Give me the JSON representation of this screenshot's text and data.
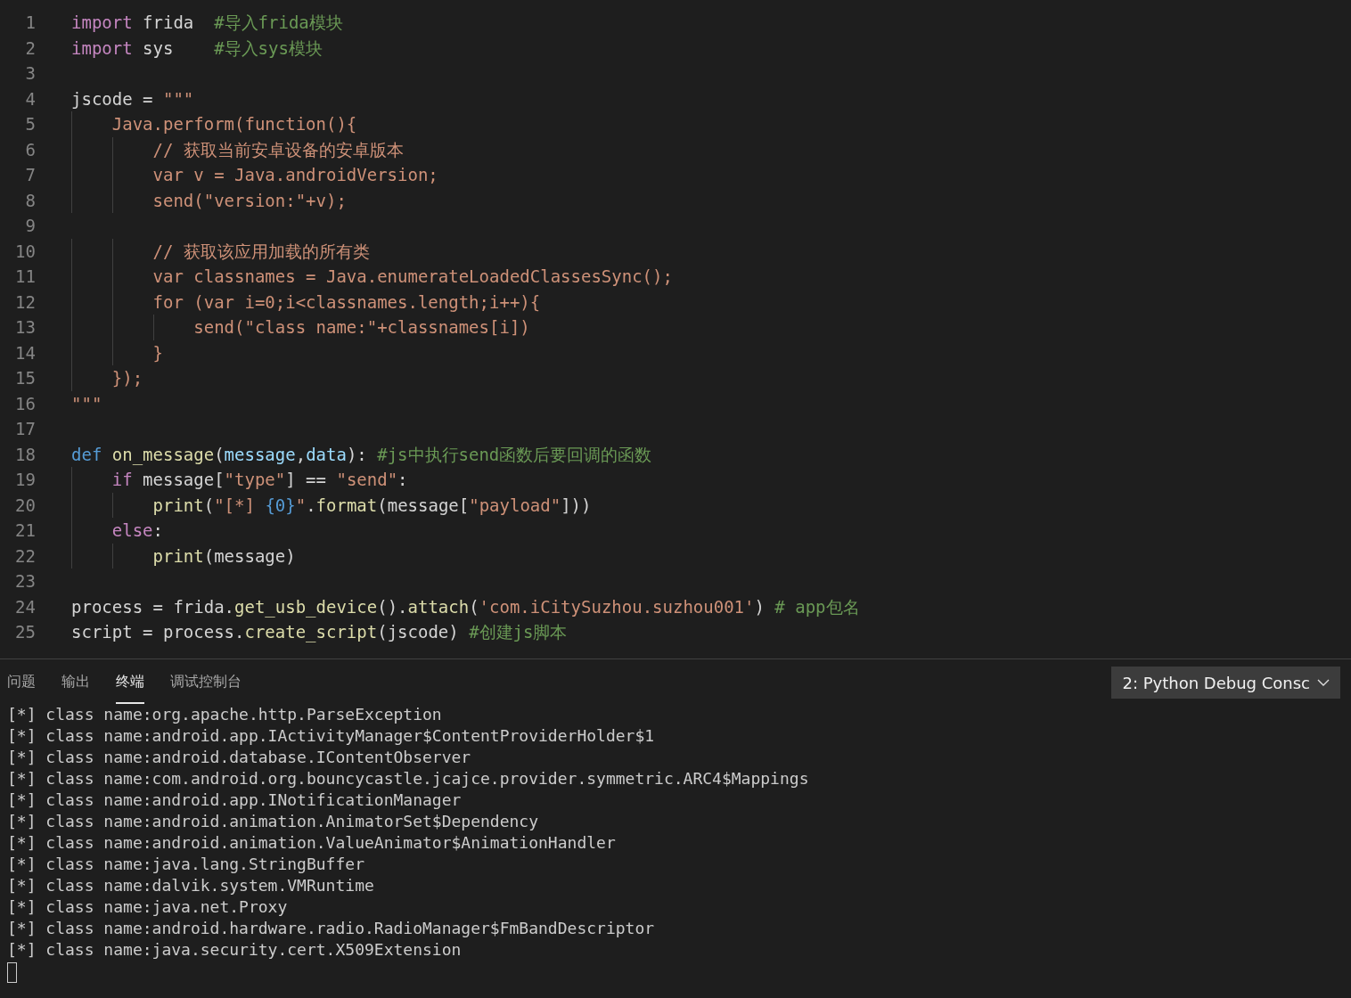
{
  "editor": {
    "lines": [
      {
        "number": "1",
        "tokens": [
          {
            "kind": "keyword",
            "text": "import"
          },
          {
            "kind": "plain",
            "text": " frida  "
          },
          {
            "kind": "comment",
            "text": "#导入frida模块"
          }
        ]
      },
      {
        "number": "2",
        "tokens": [
          {
            "kind": "keyword",
            "text": "import"
          },
          {
            "kind": "plain",
            "text": " sys    "
          },
          {
            "kind": "comment",
            "text": "#导入sys模块"
          }
        ]
      },
      {
        "number": "3"
      },
      {
        "number": "4",
        "tokens": [
          {
            "kind": "plain",
            "text": "jscode = "
          },
          {
            "kind": "string",
            "text": "\"\"\""
          }
        ]
      },
      {
        "number": "5",
        "tokens": [
          {
            "kind": "string",
            "text": "    Java.perform(function(){"
          }
        ]
      },
      {
        "number": "6",
        "tokens": [
          {
            "kind": "string",
            "text": "        // 获取当前安卓设备的安卓版本"
          }
        ]
      },
      {
        "number": "7",
        "tokens": [
          {
            "kind": "string",
            "text": "        var v = Java.androidVersion;"
          }
        ]
      },
      {
        "number": "8",
        "tokens": [
          {
            "kind": "string",
            "text": "        send(\"version:\"+v);"
          }
        ]
      },
      {
        "number": "9"
      },
      {
        "number": "10",
        "tokens": [
          {
            "kind": "string",
            "text": "        // 获取该应用加载的所有类"
          }
        ]
      },
      {
        "number": "11",
        "tokens": [
          {
            "kind": "string",
            "text": "        var classnames = Java.enumerateLoadedClassesSync();"
          }
        ]
      },
      {
        "number": "12",
        "tokens": [
          {
            "kind": "string",
            "text": "        for (var i=0;i<classnames.length;i++){"
          }
        ]
      },
      {
        "number": "13",
        "tokens": [
          {
            "kind": "string",
            "text": "            send(\"class name:\"+classnames[i])"
          }
        ]
      },
      {
        "number": "14",
        "tokens": [
          {
            "kind": "string",
            "text": "        }"
          }
        ]
      },
      {
        "number": "15",
        "tokens": [
          {
            "kind": "string",
            "text": "    });"
          }
        ]
      },
      {
        "number": "16",
        "tokens": [
          {
            "kind": "string",
            "text": "\"\"\""
          }
        ]
      },
      {
        "number": "17"
      },
      {
        "number": "18",
        "tokens": [
          {
            "kind": "storage",
            "text": "def "
          },
          {
            "kind": "function",
            "text": "on_message"
          },
          {
            "kind": "plain",
            "text": "("
          },
          {
            "kind": "variable",
            "text": "message"
          },
          {
            "kind": "plain",
            "text": ","
          },
          {
            "kind": "variable",
            "text": "data"
          },
          {
            "kind": "plain",
            "text": "): "
          },
          {
            "kind": "comment",
            "text": "#js中执行send函数后要回调的函数"
          }
        ]
      },
      {
        "number": "19",
        "tokens": [
          {
            "kind": "keyword",
            "text": "    if"
          },
          {
            "kind": "plain",
            "text": " message["
          },
          {
            "kind": "string",
            "text": "\"type\""
          },
          {
            "kind": "plain",
            "text": "] == "
          },
          {
            "kind": "string",
            "text": "\"send\""
          },
          {
            "kind": "plain",
            "text": ":"
          }
        ]
      },
      {
        "number": "20",
        "tokens": [
          {
            "kind": "function",
            "text": "        print"
          },
          {
            "kind": "plain",
            "text": "("
          },
          {
            "kind": "string",
            "text": "\"[*] "
          },
          {
            "kind": "format",
            "text": "{0}"
          },
          {
            "kind": "string",
            "text": "\""
          },
          {
            "kind": "plain",
            "text": "."
          },
          {
            "kind": "function",
            "text": "format"
          },
          {
            "kind": "plain",
            "text": "(message["
          },
          {
            "kind": "string",
            "text": "\"payload\""
          },
          {
            "kind": "plain",
            "text": "]))"
          }
        ]
      },
      {
        "number": "21",
        "tokens": [
          {
            "kind": "keyword",
            "text": "    else"
          },
          {
            "kind": "plain",
            "text": ":"
          }
        ]
      },
      {
        "number": "22",
        "tokens": [
          {
            "kind": "function",
            "text": "        print"
          },
          {
            "kind": "plain",
            "text": "(message)"
          }
        ]
      },
      {
        "number": "23"
      },
      {
        "number": "24",
        "tokens": [
          {
            "kind": "plain",
            "text": "process = frida."
          },
          {
            "kind": "function",
            "text": "get_usb_device"
          },
          {
            "kind": "plain",
            "text": "()."
          },
          {
            "kind": "function",
            "text": "attach"
          },
          {
            "kind": "plain",
            "text": "("
          },
          {
            "kind": "string",
            "text": "'com.iCitySuzhou.suzhou001'"
          },
          {
            "kind": "plain",
            "text": ") "
          },
          {
            "kind": "comment",
            "text": "# app包名"
          }
        ]
      },
      {
        "number": "25",
        "tokens": [
          {
            "kind": "plain",
            "text": "script = process."
          },
          {
            "kind": "function",
            "text": "create_script"
          },
          {
            "kind": "plain",
            "text": "(jscode) "
          },
          {
            "kind": "comment",
            "text": "#创建js脚本"
          }
        ]
      }
    ]
  },
  "panel": {
    "tabs": [
      {
        "label": "问题",
        "selected": false
      },
      {
        "label": "输出",
        "selected": false
      },
      {
        "label": "终端",
        "selected": true
      },
      {
        "label": "调试控制台",
        "selected": false
      }
    ],
    "terminal_selector": {
      "value": "2: Python Debug Consc"
    },
    "terminal": {
      "lines": [
        "[*] class name:org.apache.http.ParseException",
        "[*] class name:android.app.IActivityManager$ContentProviderHolder$1",
        "[*] class name:android.database.IContentObserver",
        "[*] class name:com.android.org.bouncycastle.jcajce.provider.symmetric.ARC4$Mappings",
        "[*] class name:android.app.INotificationManager",
        "[*] class name:android.animation.AnimatorSet$Dependency",
        "[*] class name:android.animation.ValueAnimator$AnimationHandler",
        "[*] class name:java.lang.StringBuffer",
        "[*] class name:dalvik.system.VMRuntime",
        "[*] class name:java.net.Proxy",
        "[*] class name:android.hardware.radio.RadioManager$FmBandDescriptor",
        "[*] class name:java.security.cert.X509Extension"
      ],
      "cursor_visible": true
    }
  }
}
